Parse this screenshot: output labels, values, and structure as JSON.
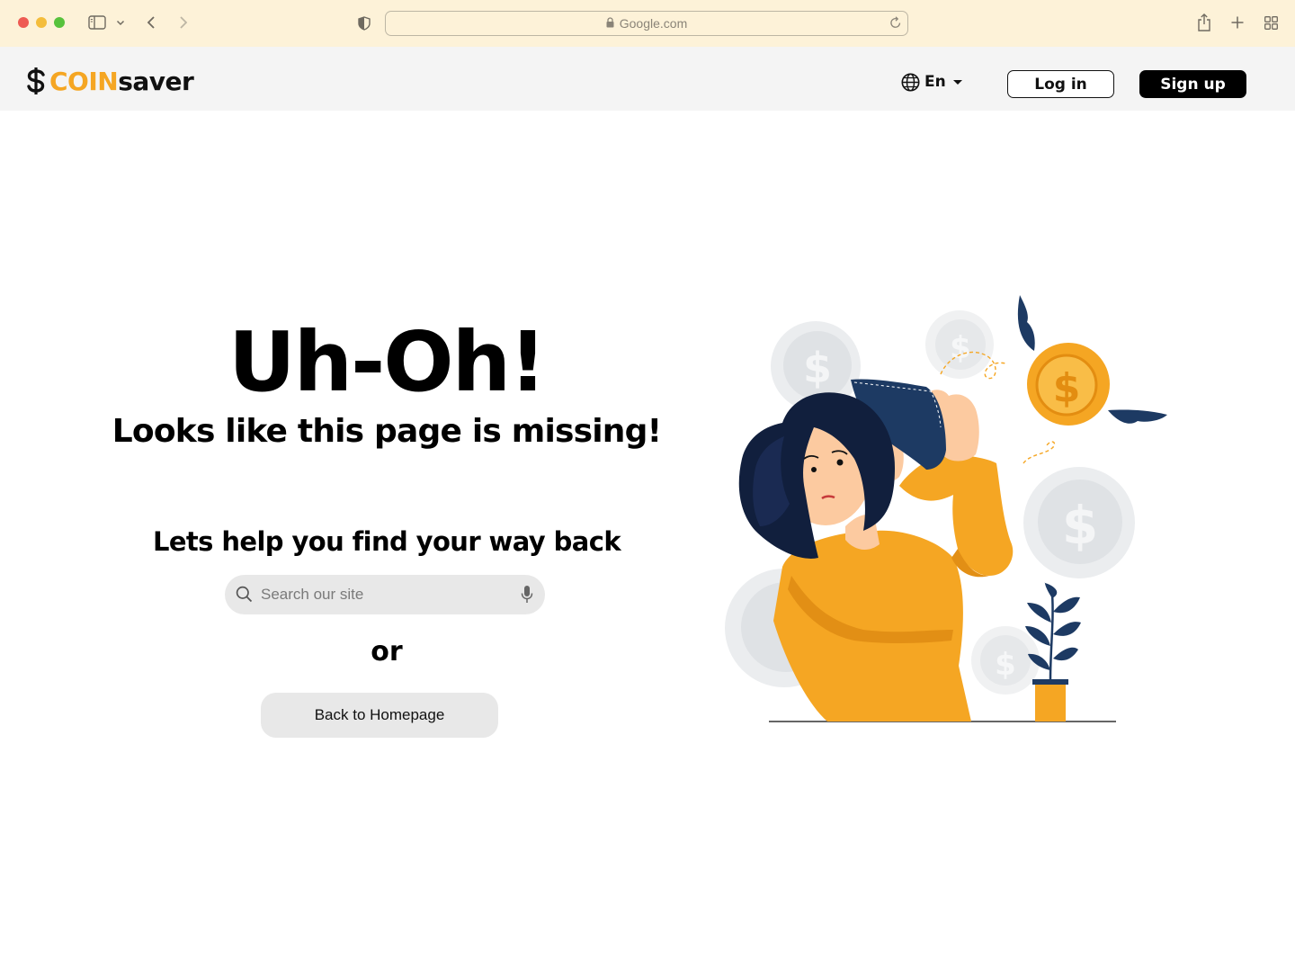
{
  "browser": {
    "url": "Google.com"
  },
  "header": {
    "logo_coin": "COIN",
    "logo_saver": "saver",
    "language": "En",
    "login_label": "Log in",
    "signup_label": "Sign up"
  },
  "main": {
    "title": "Uh-Oh!",
    "subtitle": "Looks like this page is missing!",
    "help_text": "Lets help you find your way back",
    "search_placeholder": "Search our site",
    "or_text": "or",
    "home_button": "Back to Homepage"
  },
  "colors": {
    "brand_orange": "#f5a623",
    "chrome_bg": "#fdf2d8",
    "header_bg": "#f4f4f4",
    "navy": "#1d3a63"
  },
  "icons": {
    "sidebar": "sidebar-icon",
    "back": "chevron-left-icon",
    "forward": "chevron-right-icon",
    "shield": "shield-icon",
    "lock": "lock-icon",
    "reload": "reload-icon",
    "share": "share-icon",
    "new_tab": "plus-icon",
    "tabs": "grid-icon",
    "globe": "globe-icon",
    "search": "search-icon",
    "mic": "mic-icon"
  }
}
